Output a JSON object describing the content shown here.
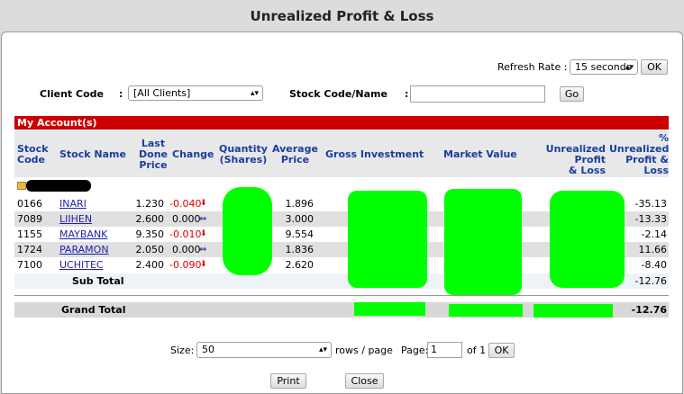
{
  "window": {
    "title": "Unrealized Profit & Loss"
  },
  "refresh": {
    "label": "Refresh Rate :",
    "value": "15 seconds",
    "ok_label": "OK"
  },
  "filters": {
    "client_label": "Client Code",
    "client_colon": ":",
    "client_value": "[All Clients]",
    "stock_label": "Stock Code/Name",
    "stock_colon": ":",
    "stock_value": "",
    "go_label": "Go"
  },
  "account_header": "My Account(s)",
  "columns": {
    "code": [
      "Stock",
      "Code"
    ],
    "name": "Stock Name",
    "last": [
      "Last",
      "Done",
      "Price"
    ],
    "change": "Change",
    "qty": [
      "Quantity",
      "(Shares)"
    ],
    "avg": [
      "Average",
      "Price"
    ],
    "gross": "Gross Investment",
    "market": "Market Value",
    "upl": [
      "Unrealized Profit",
      "& Loss"
    ],
    "pct": [
      "%",
      "Unrealized",
      "Profit &",
      "Loss"
    ]
  },
  "rows": [
    {
      "code": "0166",
      "name": "INARI",
      "last": "1.230",
      "change": "-0.040",
      "dir": "down",
      "avg": "1.896",
      "pct": "-35.13"
    },
    {
      "code": "7089",
      "name": "LIIHEN",
      "last": "2.600",
      "change": "0.000",
      "dir": "flat",
      "avg": "3.000",
      "pct": "-13.33"
    },
    {
      "code": "1155",
      "name": "MAYBANK",
      "last": "9.350",
      "change": "-0.010",
      "dir": "down",
      "avg": "9.554",
      "pct": "-2.14"
    },
    {
      "code": "1724",
      "name": "PARAMON",
      "last": "2.050",
      "change": "0.000",
      "dir": "flat",
      "avg": "1.836",
      "pct": "11.66"
    },
    {
      "code": "7100",
      "name": "UCHITEC",
      "last": "2.400",
      "change": "-0.090",
      "dir": "down",
      "avg": "2.620",
      "pct": "-8.40"
    }
  ],
  "subtotal": {
    "label": "Sub Total",
    "pct": "-12.76"
  },
  "grandtotal": {
    "label": "Grand Total",
    "pct": "-12.76"
  },
  "pager": {
    "size_label": "Size:",
    "size_value": "50",
    "rows_label": "rows / page",
    "page_label": "Page:",
    "page_value": "1",
    "of_label": "of 1",
    "ok_label": "OK"
  },
  "footer": {
    "print_label": "Print",
    "close_label": "Close"
  },
  "colors": {
    "header_red": "#cc0000",
    "link_blue": "#1f1faa",
    "negative_red": "#d60000",
    "redaction_green": "#00ff00"
  }
}
